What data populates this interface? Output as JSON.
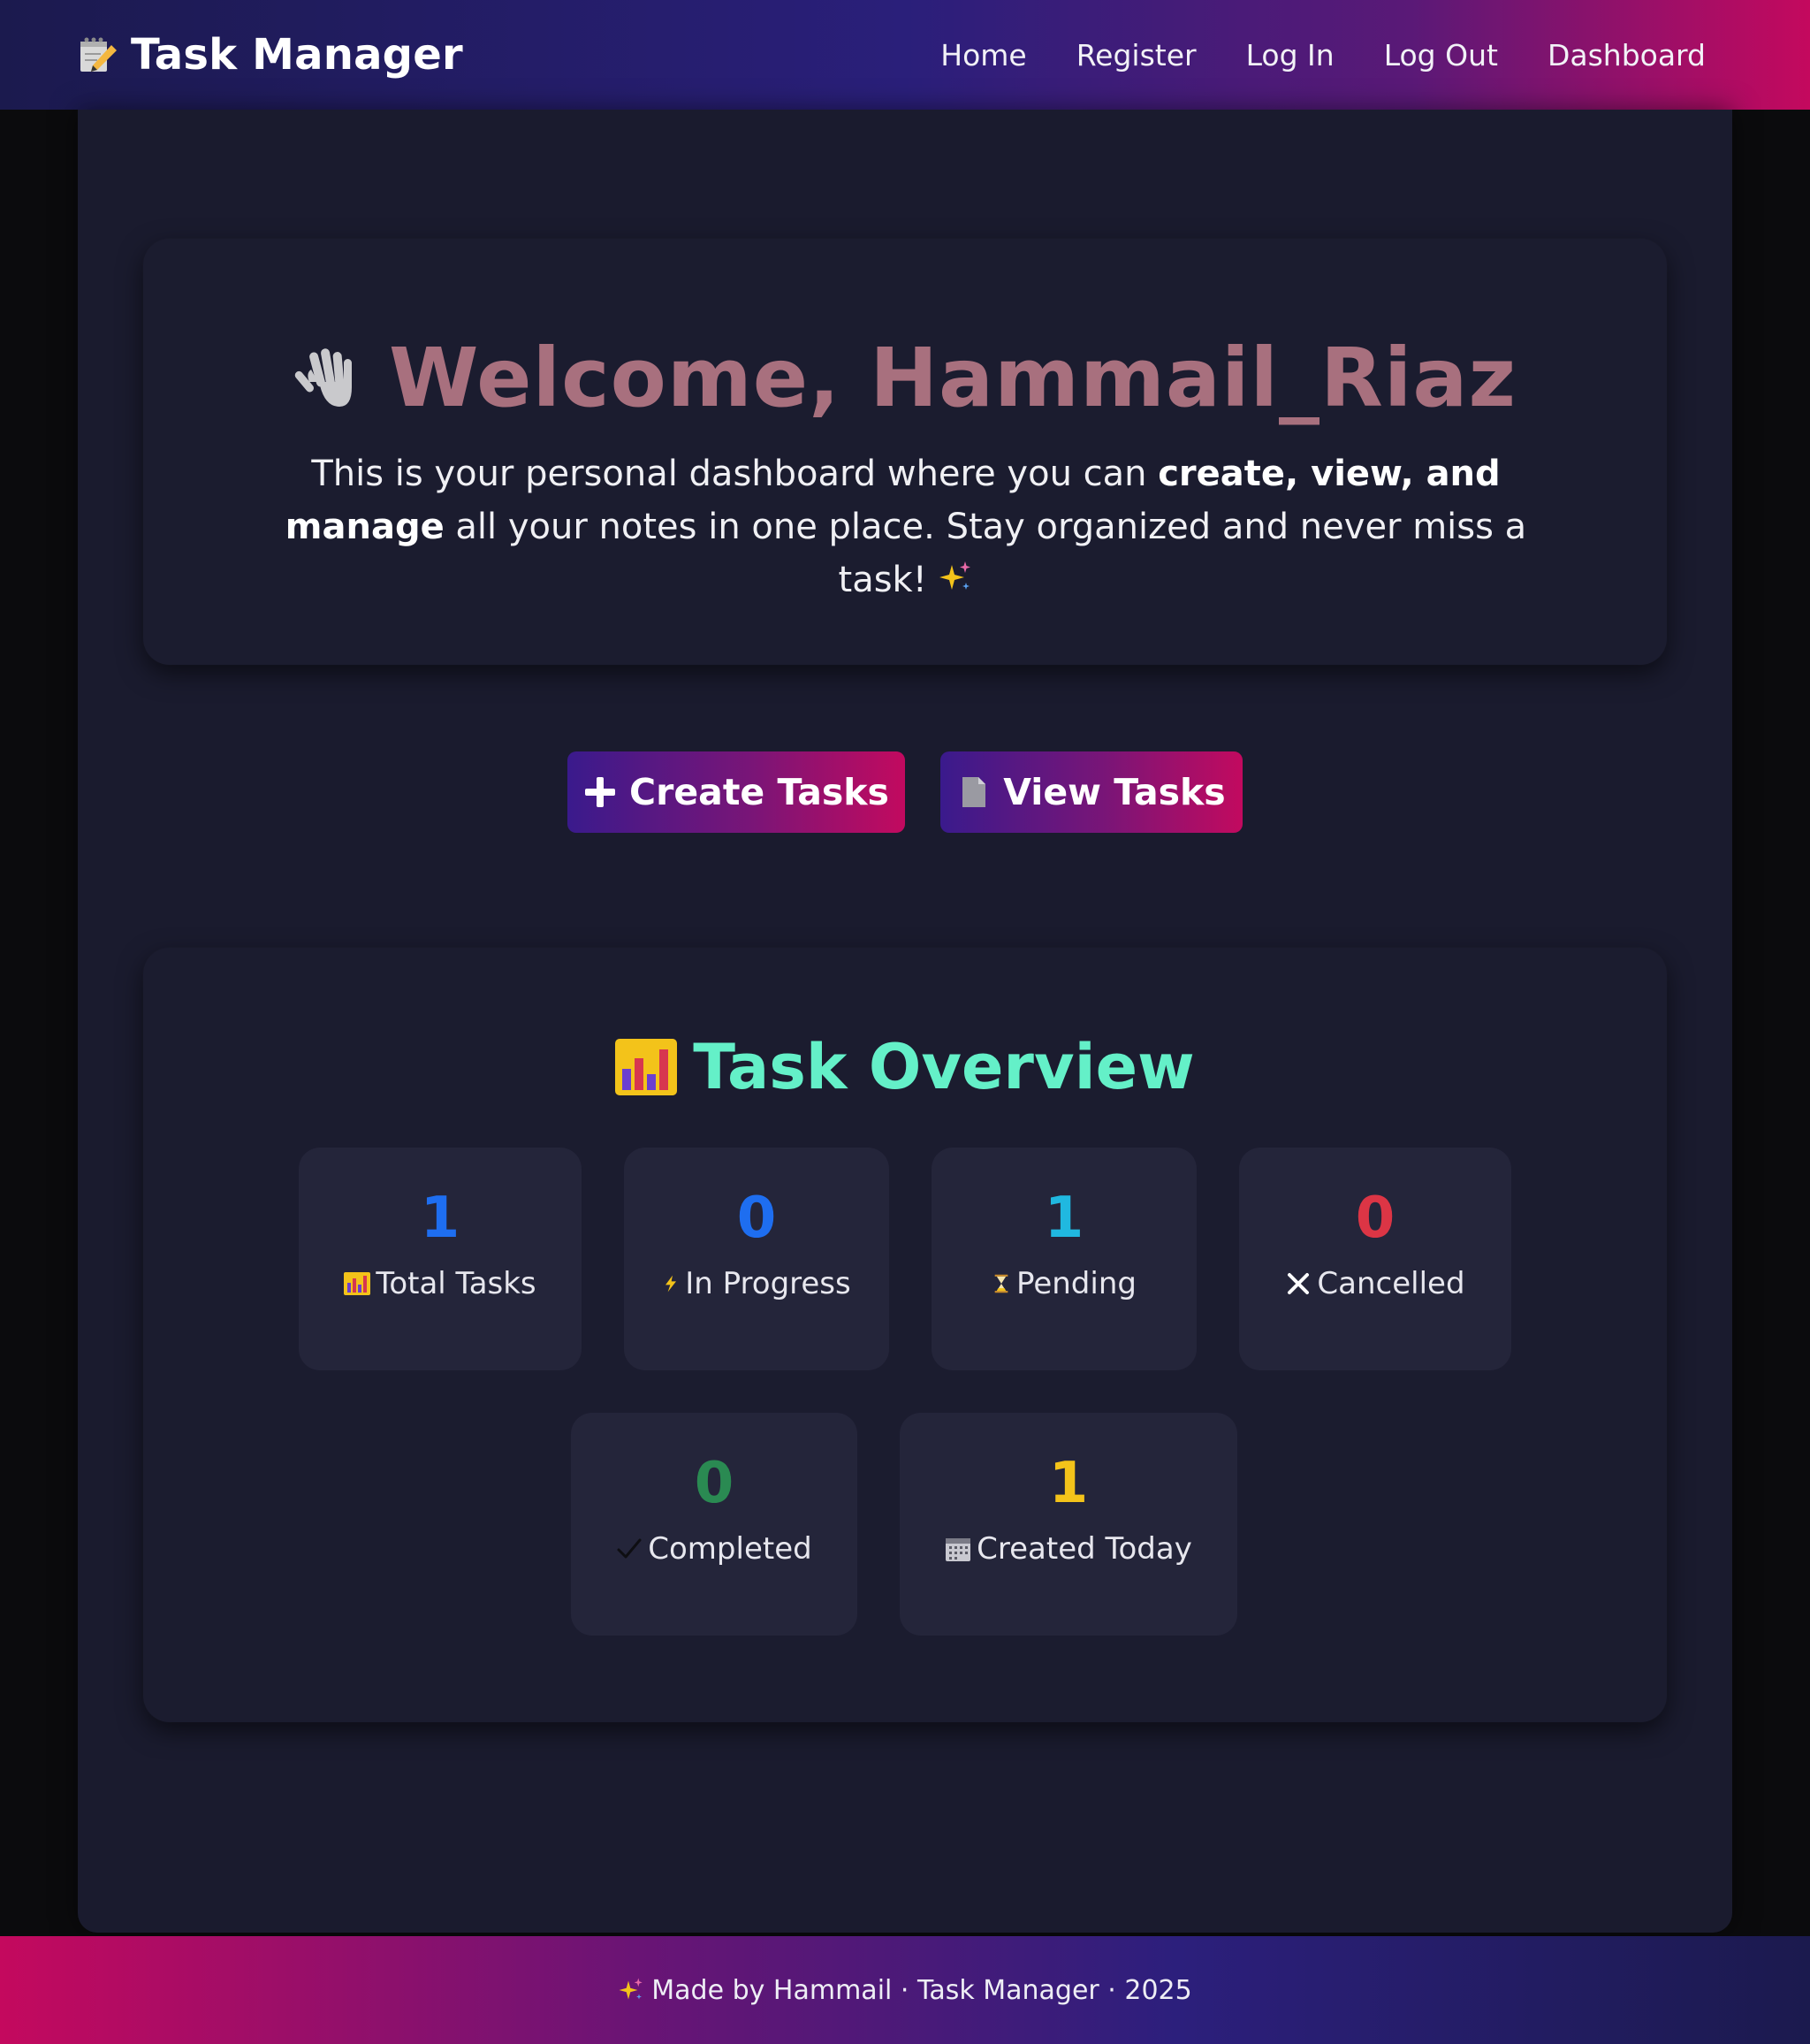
{
  "navbar": {
    "brand_icon": "memo-pencil-icon",
    "brand": "Task Manager",
    "links": [
      "Home",
      "Register",
      "Log In",
      "Log Out",
      "Dashboard"
    ]
  },
  "welcome": {
    "icon": "waving-hand-icon",
    "title": "Welcome, Hammail_Riaz",
    "desc_before": "This is your personal dashboard where you can ",
    "desc_bold": "create, view, and manage",
    "desc_after": " all your notes in one place. Stay organized and never miss a task!",
    "desc_icon": "sparkles-icon"
  },
  "actions": {
    "create_icon": "plus-icon",
    "create_label": "Create Tasks",
    "view_icon": "document-icon",
    "view_label": "View Tasks"
  },
  "overview": {
    "icon": "bar-chart-icon",
    "title": "Task Overview",
    "stats": {
      "total": {
        "value": "1",
        "label": "Total Tasks",
        "icon": "bar-chart-icon",
        "color": "#1e6ef0"
      },
      "in_progress": {
        "value": "0",
        "label": "In Progress",
        "icon": "lightning-icon",
        "color": "#1e6ef0"
      },
      "pending": {
        "value": "1",
        "label": "Pending",
        "icon": "hourglass-icon",
        "color": "#20b8e0"
      },
      "cancelled": {
        "value": "0",
        "label": "Cancelled",
        "icon": "cross-icon",
        "color": "#dc3545"
      },
      "completed": {
        "value": "0",
        "label": "Completed",
        "icon": "checkmark-icon",
        "color": "#2a8a52"
      },
      "created_today": {
        "value": "1",
        "label": "Created Today",
        "icon": "calendar-icon",
        "color": "#f3c31a"
      }
    }
  },
  "footer": {
    "icon": "sparkles-icon",
    "text": "Made by Hammail · Task Manager · 2025"
  },
  "colors": {
    "accent_gradient_start": "#2a1f7a",
    "accent_gradient_end": "#c4095e",
    "welcome_title": "#a8707e",
    "overview_title": "#64f0c8",
    "panel_bg": "#1a1b2e",
    "stat_bg": "#24253a"
  }
}
